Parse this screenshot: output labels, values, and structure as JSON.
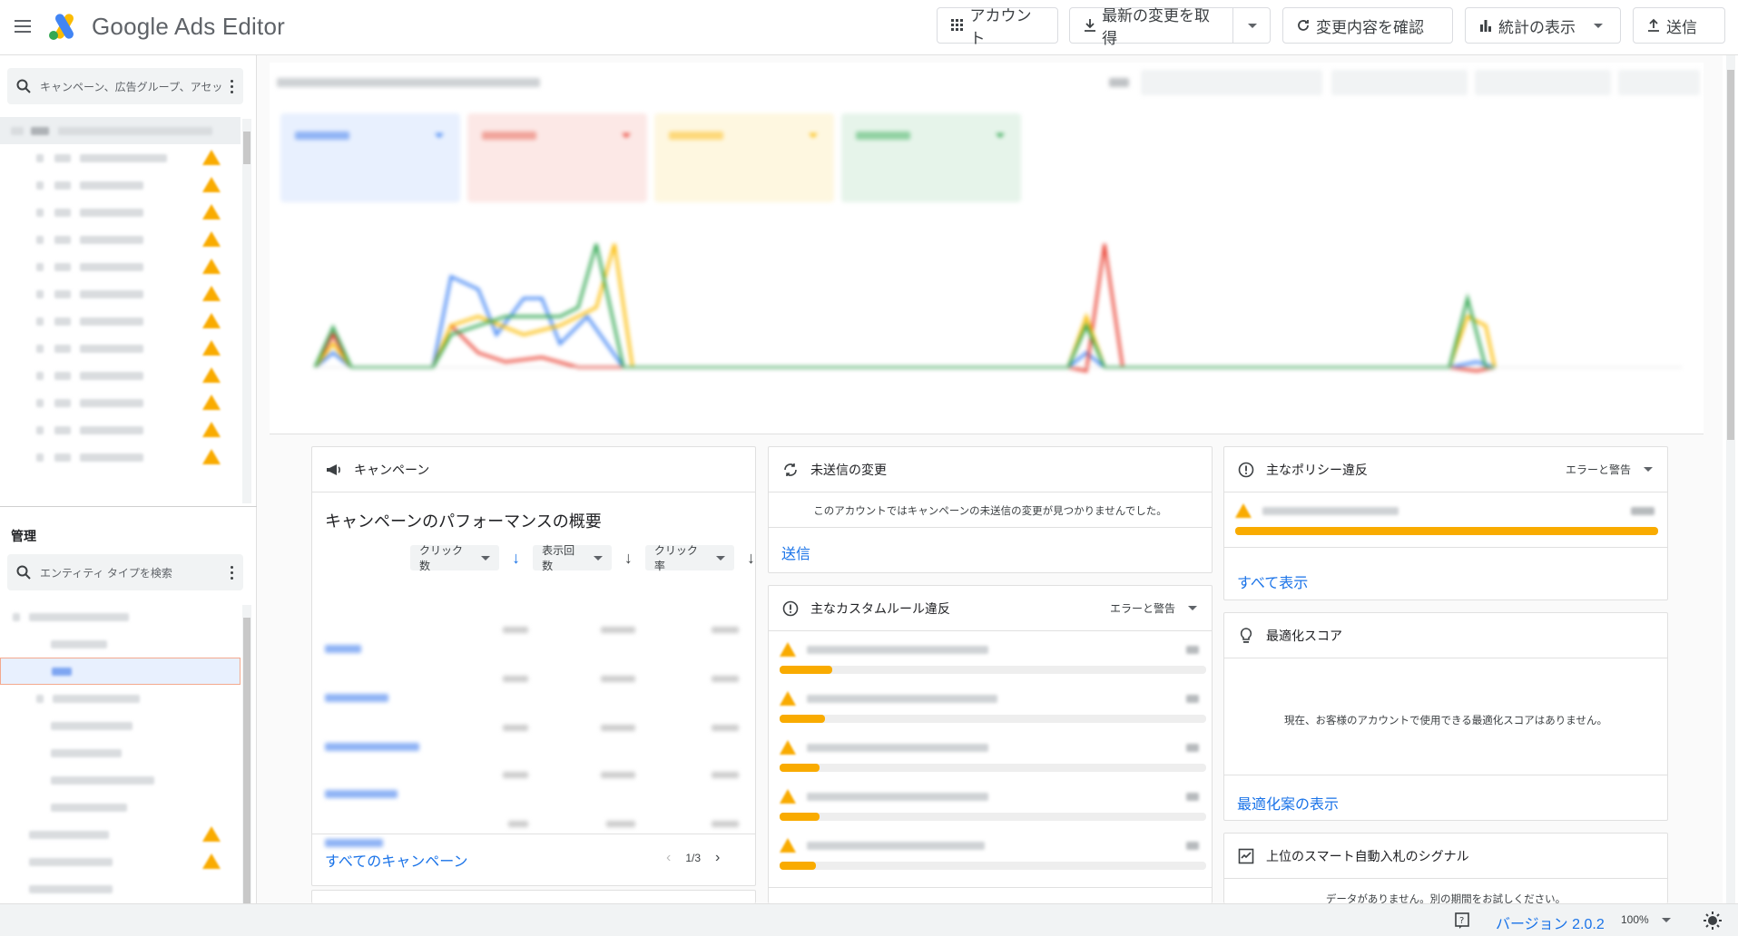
{
  "header": {
    "brand": "Google Ads Editor",
    "buttons": {
      "account": "アカウント",
      "get_changes": "最新の変更を取得",
      "check_changes": "変更内容を確認",
      "show_stats": "統計の表示",
      "post": "送信"
    }
  },
  "left_panel": {
    "search_placeholder": "キャンペーン、広告グループ、アセッ...",
    "section_title": "管理",
    "entity_search_placeholder": "エンティティ タイプを検索"
  },
  "cards": {
    "campaigns": {
      "title": "キャンペーン",
      "heading": "キャンペーンのパフォーマンスの概要",
      "sort1": "クリック数",
      "sort2": "表示回数",
      "sort3": "クリック率",
      "footer_link": "すべてのキャンペーン",
      "pagination": "1/3"
    },
    "unsent": {
      "title": "未送信の変更",
      "message": "このアカウントではキャンペーンの未送信の変更が見つかりませんでした。",
      "link": "送信"
    },
    "custom_rules": {
      "title": "主なカスタムルール違反",
      "filter": "エラーと警告"
    },
    "policy": {
      "title": "主なポリシー違反",
      "filter": "エラーと警告",
      "link": "すべて表示"
    },
    "optimization": {
      "title": "最適化スコア",
      "message": "現在、お客様のアカウントで使用できる最適化スコアはありません。",
      "link": "最適化案の表示"
    },
    "smart_bidding": {
      "title": "上位のスマート自動入札のシグナル",
      "message": "データがありません。別の期間をお試しください。"
    }
  },
  "status_bar": {
    "version": "バージョン 2.0.2",
    "zoom": "100%"
  },
  "colors": {
    "blue": "#4285f4",
    "red": "#ea4335",
    "yellow": "#fbbc04",
    "green": "#34a853",
    "link": "#1a73e8",
    "warn": "#f9ab00"
  }
}
